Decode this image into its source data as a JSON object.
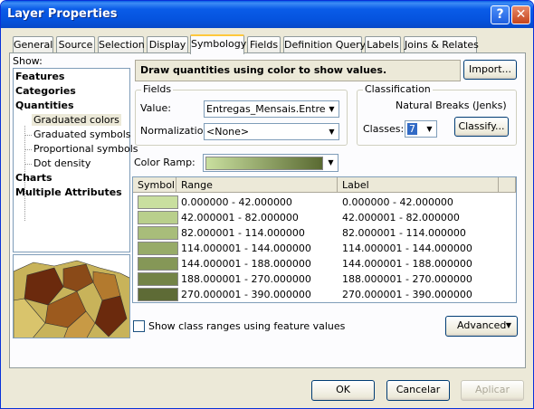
{
  "window": {
    "title": "Layer Properties"
  },
  "titlebar": {
    "help_glyph": "?",
    "close_glyph": "✕"
  },
  "tabs": [
    {
      "label": "General"
    },
    {
      "label": "Source"
    },
    {
      "label": "Selection"
    },
    {
      "label": "Display"
    },
    {
      "label": "Symbology"
    },
    {
      "label": "Fields"
    },
    {
      "label": "Definition Query"
    },
    {
      "label": "Labels"
    },
    {
      "label": "Joins & Relates"
    }
  ],
  "active_tab": "Symbology",
  "show": {
    "label": "Show:",
    "items": [
      {
        "label": "Features"
      },
      {
        "label": "Categories"
      },
      {
        "label": "Quantities"
      },
      {
        "label": "Graduated colors"
      },
      {
        "label": "Graduated symbols"
      },
      {
        "label": "Proportional symbols"
      },
      {
        "label": "Dot density"
      },
      {
        "label": "Charts"
      },
      {
        "label": "Multiple Attributes"
      }
    ],
    "selected": "Graduated colors"
  },
  "description": "Draw quantities using color to show values.",
  "import_button": "Import...",
  "fields": {
    "group_label": "Fields",
    "value_label": "Value:",
    "value": "Entregas_Mensais.Entregas",
    "normalization_label": "Normalization:",
    "normalization": "<None>"
  },
  "classification": {
    "group_label": "Classification",
    "method": "Natural Breaks (Jenks)",
    "classes_label": "Classes:",
    "classes": "7",
    "classify_button": "Classify..."
  },
  "color_ramp": {
    "label": "Color Ramp:"
  },
  "table": {
    "headers": {
      "symbol": "Symbol",
      "range": "Range",
      "label": "Label"
    },
    "rows": [
      {
        "color": "#c9df9f",
        "range": "0.000000 - 42.000000",
        "label": "0.000000 - 42.000000"
      },
      {
        "color": "#b9cf8c",
        "range": "42.000001 - 82.000000",
        "label": "42.000001 - 82.000000"
      },
      {
        "color": "#a8bd7a",
        "range": "82.000001 - 114.000000",
        "label": "82.000001 - 114.000000"
      },
      {
        "color": "#97ab68",
        "range": "114.000001 - 144.000000",
        "label": "114.000001 - 144.000000"
      },
      {
        "color": "#859757",
        "range": "144.000001 - 188.000000",
        "label": "144.000001 - 188.000000"
      },
      {
        "color": "#738347",
        "range": "188.000001 - 270.000000",
        "label": "188.000001 - 270.000000"
      },
      {
        "color": "#5e6b36",
        "range": "270.000001 - 390.000000",
        "label": "270.000001 - 390.000000"
      }
    ]
  },
  "show_class_ranges": {
    "label": "Show class ranges using feature values",
    "checked": false
  },
  "advanced_button": "Advanced",
  "dialog_buttons": {
    "ok": "OK",
    "cancel": "Cancelar",
    "apply": "Aplicar"
  },
  "colors": {
    "titlebar": "#0553de",
    "dialog_bg": "#ece9d8",
    "tab_highlight": "#ffc83c"
  }
}
